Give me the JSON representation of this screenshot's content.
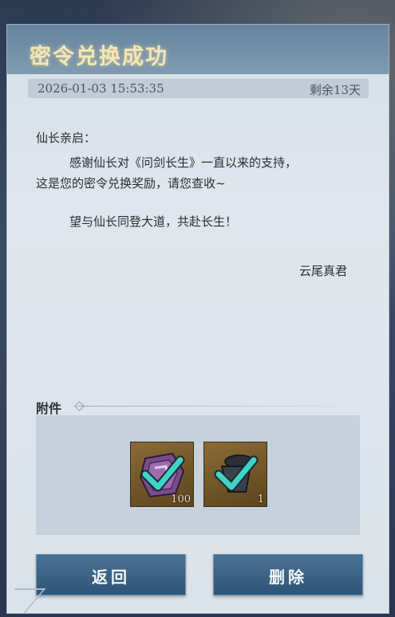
{
  "mail": {
    "title": "密令兑换成功",
    "date": "2026-01-03 15:53:35",
    "remaining": "剩余13天",
    "salutation": "仙长亲启：",
    "line1": "感谢仙长对《问剑长生》一直以来的支持，",
    "line2": "这是您的密令兑换奖励，请您查收~",
    "line3": "望与仙长同登大道，共赴长生！",
    "signature": "云尾真君"
  },
  "attachments": {
    "label": "附件",
    "items": [
      {
        "icon": "purple-token-icon",
        "qty": "100",
        "claimed": true
      },
      {
        "icon": "armor-bundle-icon",
        "qty": "1",
        "claimed": true
      }
    ]
  },
  "buttons": {
    "back": "返回",
    "delete": "删除"
  },
  "colors": {
    "title": "#f4e7b2",
    "check": "#3fd4c6",
    "button": "#3a6384"
  }
}
